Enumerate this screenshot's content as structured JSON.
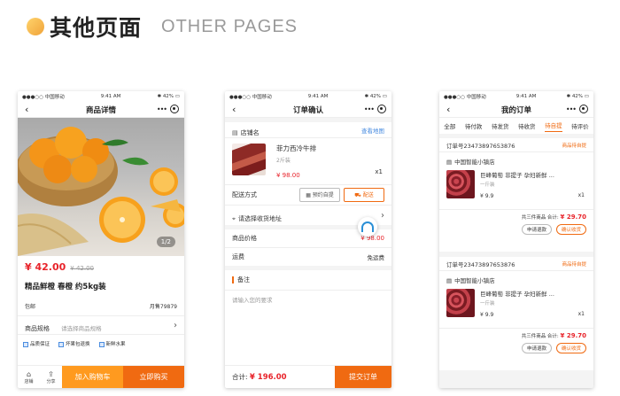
{
  "header": {
    "title_cn": "其他页面",
    "title_en": "OTHER PAGES"
  },
  "status": {
    "carrier": "●●●○○ 中国移动",
    "time": "9:41 AM",
    "battery": "42%"
  },
  "detail": {
    "title": "商品详情",
    "image_counter": "1/2",
    "price": "¥ 42.00",
    "old_price": "¥ 42.00",
    "name": "精品鲜橙 春橙 约5kg装",
    "shipping": "包邮",
    "monthly_sales": "月售79879",
    "spec_label": "商品规格",
    "spec_value": "请选择商品规格",
    "guarantees": [
      "品质保证",
      "坏果包退换",
      "新鲜水果"
    ],
    "store_label": "店铺",
    "share_label": "分享",
    "add_cart": "加入购物车",
    "buy_now": "立即购买"
  },
  "confirm": {
    "title": "订单确认",
    "store": "店铺名",
    "view_map": "查看地图",
    "product_name": "菲力西冷牛排",
    "product_weight": "2斤装",
    "product_price": "¥ 98.00",
    "product_qty": "x1",
    "delivery_label": "配送方式",
    "opt_pickup": "预约自提",
    "opt_delivery": "配送",
    "address_placeholder": "请选择收货地址",
    "goods_price_label": "商品价格",
    "goods_price": "¥ 98.00",
    "freight_label": "运费",
    "freight_value": "免运费",
    "remark_label": "备注",
    "remark_placeholder": "请输入您的要求",
    "total_label": "合计:",
    "total_value": "¥ 196.00",
    "submit": "提交订单"
  },
  "orders": {
    "title": "我的订单",
    "tabs": [
      "全部",
      "待付款",
      "待发货",
      "待收货",
      "待自提",
      "待评价"
    ],
    "active_tab": 4,
    "list": [
      {
        "order_no": "订单号23473897653876",
        "status": "商品待自提",
        "store": "中国智能小镇店",
        "product": "巨峰葡萄 非提子 孕妇新鲜 ...",
        "spec": "一斤装",
        "price": "¥ 9.9",
        "qty": "x1",
        "summary": "共三件商品 合计:",
        "total": "¥ 29.70",
        "btn_secondary": "申请退款",
        "btn_primary": "确认收货"
      },
      {
        "order_no": "订单号23473897653876",
        "status": "商品待自提",
        "store": "中国智能小镇店",
        "product": "巨峰葡萄 非提子 孕妇新鲜 ...",
        "spec": "一斤装",
        "price": "¥ 9.9",
        "qty": "x1",
        "summary": "共三件商品 合计:",
        "total": "¥ 29.70",
        "btn_secondary": "申请退款",
        "btn_primary": "确认收货"
      }
    ]
  },
  "colors": {
    "accent": "#f06a11",
    "price_red": "#e8232a",
    "cart_yellow": "#ff9a1f",
    "link_blue": "#4a8de0"
  }
}
